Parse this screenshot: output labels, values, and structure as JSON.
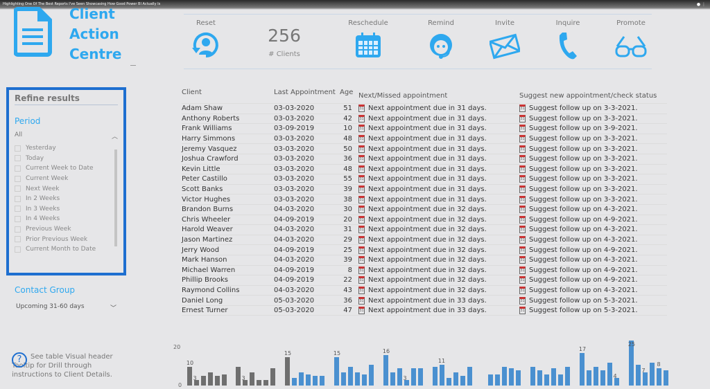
{
  "video_title": "Highlighting One Of The Best Reports I've Seen Showcasing How Good Power BI Actually Is",
  "app": {
    "title_lines": [
      "Client",
      "Action",
      "Centre"
    ],
    "accent": "#2ea8ef"
  },
  "actions": [
    {
      "label": "Reset",
      "icon": "reset-user-icon"
    },
    {
      "label": "Reschedule",
      "icon": "calendar-icon"
    },
    {
      "label": "Remind",
      "icon": "headset-icon"
    },
    {
      "label": "Invite",
      "icon": "envelope-icon"
    },
    {
      "label": "Inquire",
      "icon": "phone-icon"
    },
    {
      "label": "Promote",
      "icon": "glasses-icon"
    }
  ],
  "kpi": {
    "value": "256",
    "label": "# Clients"
  },
  "filters": {
    "heading": "Refine results",
    "period_label": "Period",
    "period_selected": "All",
    "period_options": [
      "Yesterday",
      "Today",
      "Current Week to Date",
      "Current Week",
      "Next Week",
      "In 2 Weeks",
      "In 3 Weeks",
      "In 4 Weeks",
      "Previous Week",
      "Prior Previous Week",
      "Current Month to Date"
    ],
    "contact_group_label": "Contact Group",
    "contact_group_value": "Upcoming 31-60 days"
  },
  "help_text": "See table Visual header Tooltip for Drill through instructions to Client Details.",
  "table": {
    "columns": [
      "Client",
      "Last Appointment",
      "Age",
      "Next/Missed appointment",
      "Suggest new appointment/check status"
    ],
    "rows": [
      [
        "Adam Shaw",
        "03-03-2020",
        "51",
        "Next appointment due in 31 days.",
        "Suggest follow up on 3-3-2021."
      ],
      [
        "Anthony Roberts",
        "03-03-2020",
        "42",
        "Next appointment due in 31 days.",
        "Suggest follow up on 3-3-2021."
      ],
      [
        "Frank Williams",
        "03-09-2019",
        "10",
        "Next appointment due in 31 days.",
        "Suggest follow up on 3-9-2021."
      ],
      [
        "Harry Simmons",
        "03-03-2020",
        "48",
        "Next appointment due in 31 days.",
        "Suggest follow up on 3-3-2021."
      ],
      [
        "Jeremy Vasquez",
        "03-03-2020",
        "50",
        "Next appointment due in 31 days.",
        "Suggest follow up on 3-3-2021."
      ],
      [
        "Joshua Crawford",
        "03-03-2020",
        "36",
        "Next appointment due in 31 days.",
        "Suggest follow up on 3-3-2021."
      ],
      [
        "Kevin Little",
        "03-03-2020",
        "48",
        "Next appointment due in 31 days.",
        "Suggest follow up on 3-3-2021."
      ],
      [
        "Peter Castillo",
        "03-03-2020",
        "55",
        "Next appointment due in 31 days.",
        "Suggest follow up on 3-3-2021."
      ],
      [
        "Scott Banks",
        "03-03-2020",
        "39",
        "Next appointment due in 31 days.",
        "Suggest follow up on 3-3-2021."
      ],
      [
        "Victor Hughes",
        "03-03-2020",
        "38",
        "Next appointment due in 31 days.",
        "Suggest follow up on 3-3-2021."
      ],
      [
        "Brandon Burns",
        "04-03-2020",
        "30",
        "Next appointment due in 32 days.",
        "Suggest follow up on 4-3-2021."
      ],
      [
        "Chris Wheeler",
        "04-09-2019",
        "20",
        "Next appointment due in 32 days.",
        "Suggest follow up on 4-9-2021."
      ],
      [
        "Harold Weaver",
        "04-03-2020",
        "31",
        "Next appointment due in 32 days.",
        "Suggest follow up on 4-3-2021."
      ],
      [
        "Jason Martinez",
        "04-03-2020",
        "29",
        "Next appointment due in 32 days.",
        "Suggest follow up on 4-3-2021."
      ],
      [
        "Jerry Wood",
        "04-09-2019",
        "25",
        "Next appointment due in 32 days.",
        "Suggest follow up on 4-9-2021."
      ],
      [
        "Mark Hanson",
        "04-03-2020",
        "39",
        "Next appointment due in 32 days.",
        "Suggest follow up on 4-3-2021."
      ],
      [
        "Michael Warren",
        "04-09-2019",
        "8",
        "Next appointment due in 32 days.",
        "Suggest follow up on 4-9-2021."
      ],
      [
        "Phillip Brooks",
        "04-09-2019",
        "22",
        "Next appointment due in 32 days.",
        "Suggest follow up on 4-9-2021."
      ],
      [
        "Raymond Collins",
        "04-03-2020",
        "43",
        "Next appointment due in 32 days.",
        "Suggest follow up on 4-3-2021."
      ],
      [
        "Daniel Long",
        "05-03-2020",
        "36",
        "Next appointment due in 33 days.",
        "Suggest follow up on 5-3-2021."
      ],
      [
        "Ernest Turner",
        "05-03-2020",
        "47",
        "Next appointment due in 33 days.",
        "Suggest follow up on 5-3-2021."
      ]
    ]
  },
  "chart_data": {
    "type": "bar",
    "ylim": [
      0,
      20
    ],
    "yticks": [
      "0",
      "20"
    ],
    "colors": {
      "past": "#6f6f6f",
      "future": "#4a90d0"
    },
    "groups": [
      [
        10,
        3,
        5,
        7,
        5,
        6
      ],
      [
        10,
        3,
        7,
        3,
        3,
        9
      ],
      [
        15,
        4,
        7,
        6,
        5,
        5
      ],
      [
        15,
        7,
        10,
        7,
        6,
        11
      ],
      [
        16,
        7,
        9,
        3,
        9,
        9
      ],
      [
        10,
        11,
        4,
        7,
        5,
        10
      ],
      [
        6,
        6,
        10,
        9,
        8
      ],
      [
        10,
        8,
        6,
        9,
        6,
        10
      ],
      [
        17,
        8,
        10,
        8,
        12,
        4
      ],
      [
        25,
        11,
        7,
        12,
        9,
        8
      ]
    ],
    "gray_count": 13,
    "labels": {
      "0": "10",
      "1": "3",
      "7": "3",
      "12": "15",
      "18": "15",
      "24": "16",
      "27": "3",
      "31": "11",
      "47": "17",
      "52": "4",
      "53": "25",
      "55": "7",
      "57": "8"
    }
  }
}
